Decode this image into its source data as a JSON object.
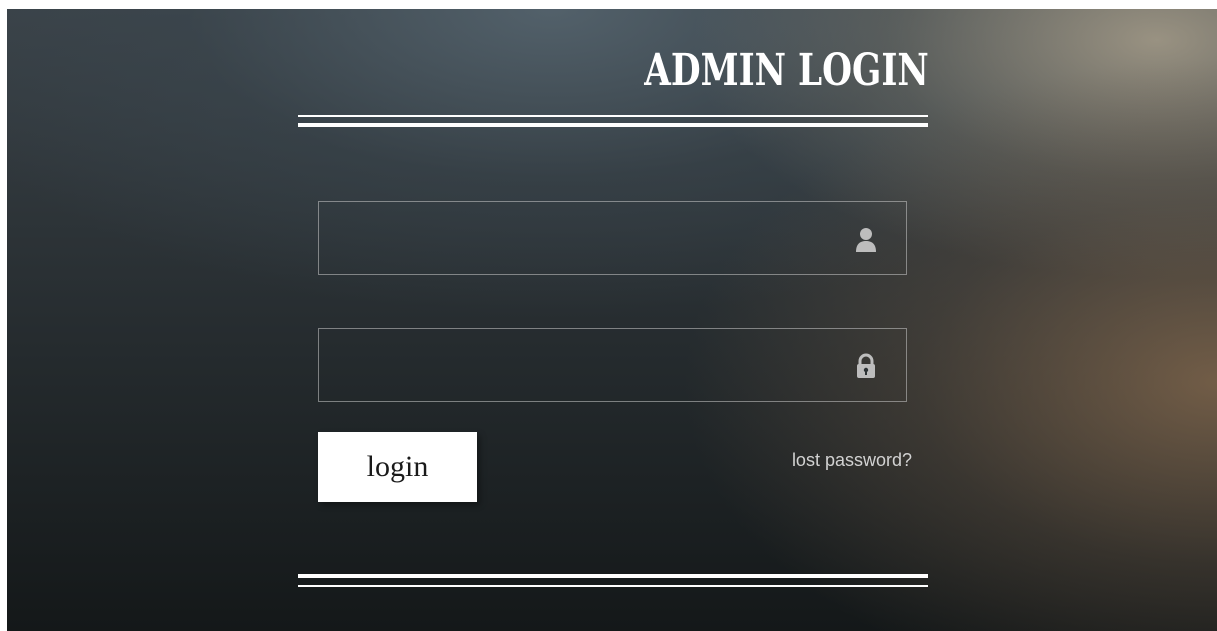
{
  "header": {
    "title": "ADMIN LOGIN"
  },
  "form": {
    "username": {
      "value": "",
      "icon": "user-icon"
    },
    "password": {
      "value": "",
      "icon": "lock-icon"
    },
    "login_label": "login",
    "lost_password_label": "lost password?"
  },
  "colors": {
    "text": "#ffffff",
    "button_bg": "#ffffff",
    "link": "#d2d2d2",
    "field_border": "#8a8a8a"
  }
}
